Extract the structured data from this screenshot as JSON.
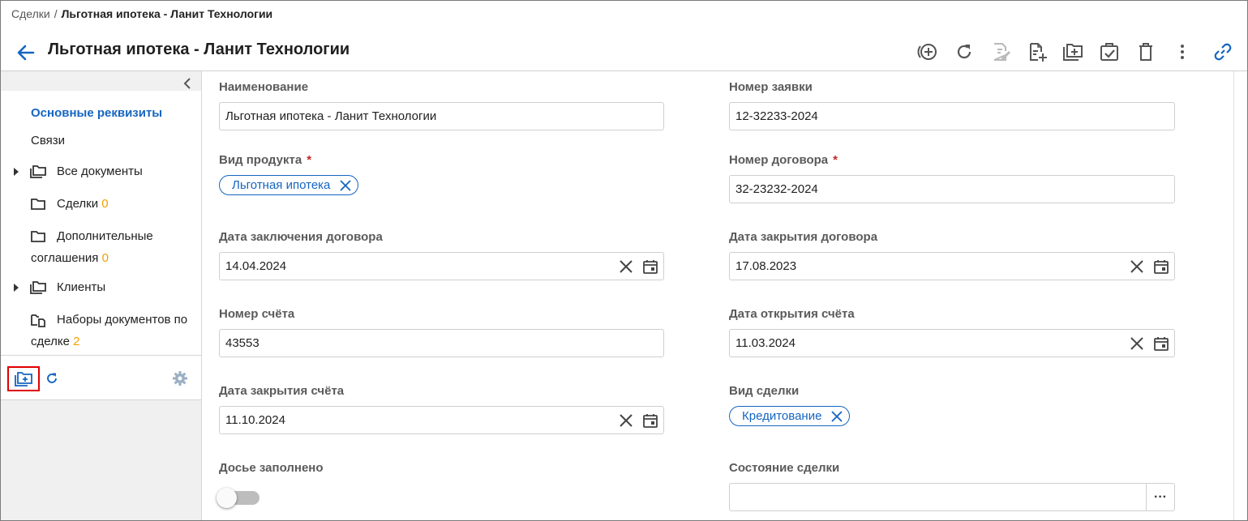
{
  "breadcrumb": {
    "root": "Сделки",
    "separator": "/",
    "current": "Льготная ипотека - Ланит Технологии"
  },
  "page": {
    "title": "Льготная ипотека - Ланит Технологии"
  },
  "toolbar": {
    "icons": [
      "add-circle-icon",
      "refresh-icon",
      "edit-document-icon",
      "add-document-icon",
      "add-folder-icon",
      "task-check-icon",
      "delete-icon",
      "more-vertical-icon",
      "link-icon"
    ]
  },
  "sidebar": {
    "items": [
      {
        "label": "Основные реквизиты",
        "count": ""
      },
      {
        "label": "Связи",
        "count": ""
      },
      {
        "label": "Все документы",
        "count": ""
      },
      {
        "label": "Сделки",
        "count": "0"
      },
      {
        "label": "Дополнительные",
        "label2": "соглашения",
        "count": "0"
      },
      {
        "label": "Клиенты",
        "count": ""
      },
      {
        "label": "Наборы документов по",
        "label2": "сделке",
        "count": "2"
      }
    ]
  },
  "form": {
    "name": {
      "label": "Наименование",
      "value": "Льготная ипотека - Ланит Технологии"
    },
    "application_number": {
      "label": "Номер заявки",
      "value": "12-32233-2024"
    },
    "product_type": {
      "label": "Вид продукта",
      "required": "*",
      "chip": "Льготная ипотека"
    },
    "contract_number": {
      "label": "Номер договора",
      "required": "*",
      "value": "32-23232-2024"
    },
    "contract_date": {
      "label": "Дата заключения договора",
      "value": "14.04.2024"
    },
    "contract_close_date": {
      "label": "Дата закрытия договора",
      "value": "17.08.2023"
    },
    "account_number": {
      "label": "Номер счёта",
      "value": "43553"
    },
    "account_open_date": {
      "label": "Дата открытия счёта",
      "value": "11.03.2024"
    },
    "account_close_date": {
      "label": "Дата закрытия счёта",
      "value": "11.10.2024"
    },
    "deal_type": {
      "label": "Вид сделки",
      "chip": "Кредитование"
    },
    "dossier_complete": {
      "label": "Досье заполнено",
      "checked": false
    },
    "deal_state": {
      "label": "Состояние сделки",
      "value": "",
      "button": "···"
    }
  },
  "colors": {
    "accent": "#1565c0",
    "count": "#f0a000",
    "required": "#c62828",
    "highlight_box": "#e00000"
  }
}
